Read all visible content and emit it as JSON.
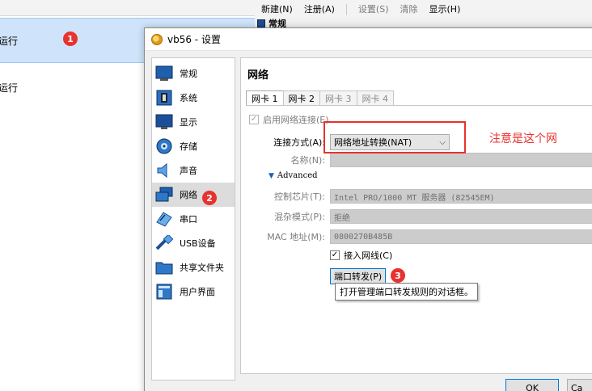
{
  "manager": {
    "toolbar": {
      "new": "新建(N)",
      "register": "注册(A)",
      "settings": "设置(S)",
      "clear": "清除",
      "show": "显示(H)"
    },
    "details_heading": "常规",
    "vms": [
      {
        "state": "运行"
      },
      {
        "state": "运行"
      }
    ]
  },
  "annotations": {
    "badge1": "1",
    "badge2": "2",
    "badge3": "3",
    "note": "注意是这个网",
    "accent": "#e8322f"
  },
  "dialog": {
    "title": "vb56 - 设置",
    "sidebar": [
      {
        "label": "常规",
        "icon": "general-icon"
      },
      {
        "label": "系统",
        "icon": "system-icon"
      },
      {
        "label": "显示",
        "icon": "display-icon"
      },
      {
        "label": "存储",
        "icon": "storage-icon"
      },
      {
        "label": "声音",
        "icon": "audio-icon"
      },
      {
        "label": "网络",
        "icon": "network-icon"
      },
      {
        "label": "串口",
        "icon": "serial-port-icon"
      },
      {
        "label": "USB设备",
        "icon": "usb-icon"
      },
      {
        "label": "共享文件夹",
        "icon": "shared-folder-icon"
      },
      {
        "label": "用户界面",
        "icon": "user-interface-icon"
      }
    ],
    "panel_title": "网络",
    "tabs": [
      "网卡 1",
      "网卡 2",
      "网卡 3",
      "网卡 4"
    ],
    "enable_adapter": "启用网络连接(E)",
    "attached_to_label": "连接方式(A):",
    "attached_to_value": "网络地址转换(NAT)",
    "name_label": "名称(N):",
    "advanced": "Advanced",
    "adapter_type_label": "控制芯片(T):",
    "adapter_type_value": "Intel PRO/1000 MT 服务器 (82545EM)",
    "promiscuous_label": "混杂模式(P):",
    "promiscuous_value": "拒绝",
    "mac_label": "MAC 地址(M):",
    "mac_value": "0800270B485B",
    "cable_connected": "接入网线(C)",
    "port_forwarding": "端口转发(P)",
    "tooltip": "打开管理端口转发规则的对话框。",
    "ok": "OK",
    "cancel": "Ca"
  }
}
